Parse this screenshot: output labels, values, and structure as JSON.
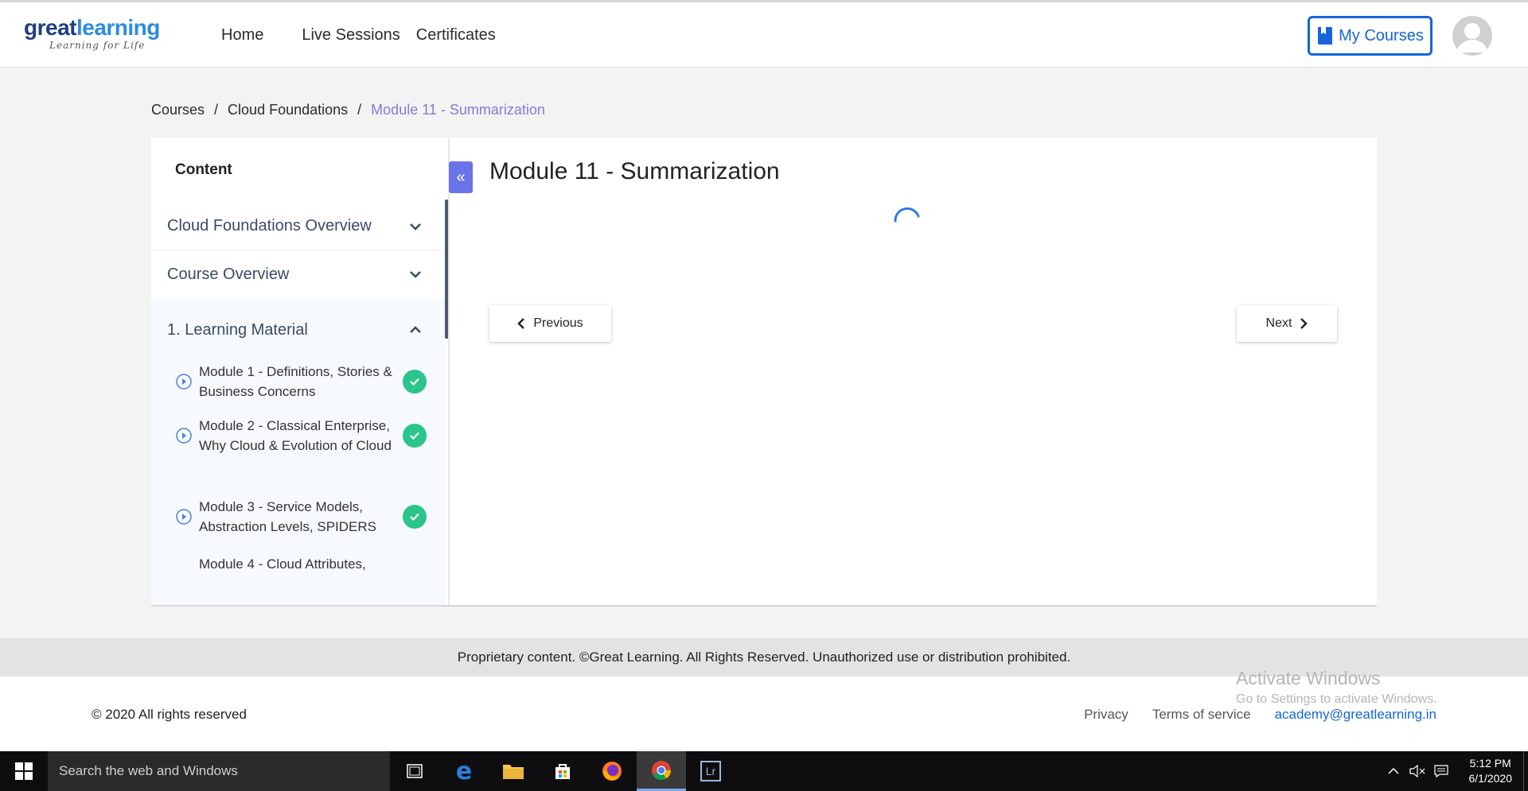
{
  "header": {
    "logo": {
      "part1": "great",
      "part2": "learning",
      "tagline": "Learning for Life"
    },
    "nav": [
      "Home",
      "Live Sessions",
      "Certificates"
    ],
    "my_courses": "My Courses"
  },
  "breadcrumb": [
    "Courses",
    "Cloud Foundations",
    "Module 11 - Summarization"
  ],
  "sidebar": {
    "title": "Content",
    "sections": [
      "Cloud Foundations Overview",
      "Course Overview",
      "1. Learning Material"
    ],
    "modules": [
      "Module 1 - Definitions, Stories & Business Concerns",
      "Module 2 - Classical Enterprise, Why Cloud & Evolution of Cloud",
      "Module 3 - Service Models, Abstraction Levels, SPIDERS",
      "Module 4 - Cloud Attributes,"
    ]
  },
  "main": {
    "title": "Module 11 - Summarization",
    "prev": "Previous",
    "next": "Next"
  },
  "footer": {
    "proprietary": "Proprietary content. ©Great Learning. All Rights Reserved. Unauthorized use or distribution prohibited.",
    "copyright": "© 2020 All rights reserved",
    "links": [
      "Privacy",
      "Terms of service",
      "academy@greatlearning.in"
    ]
  },
  "watermark": {
    "line1": "Activate Windows",
    "line2": "Go to Settings to activate Windows."
  },
  "taskbar": {
    "search_placeholder": "Search the web and Windows",
    "time": "5:12 PM",
    "date": "6/1/2020"
  },
  "colors": {
    "accent": "#1565d8",
    "breadcrumb_active": "#8a78d8",
    "complete": "#2bc48a",
    "collapse": "#6b73e8"
  }
}
